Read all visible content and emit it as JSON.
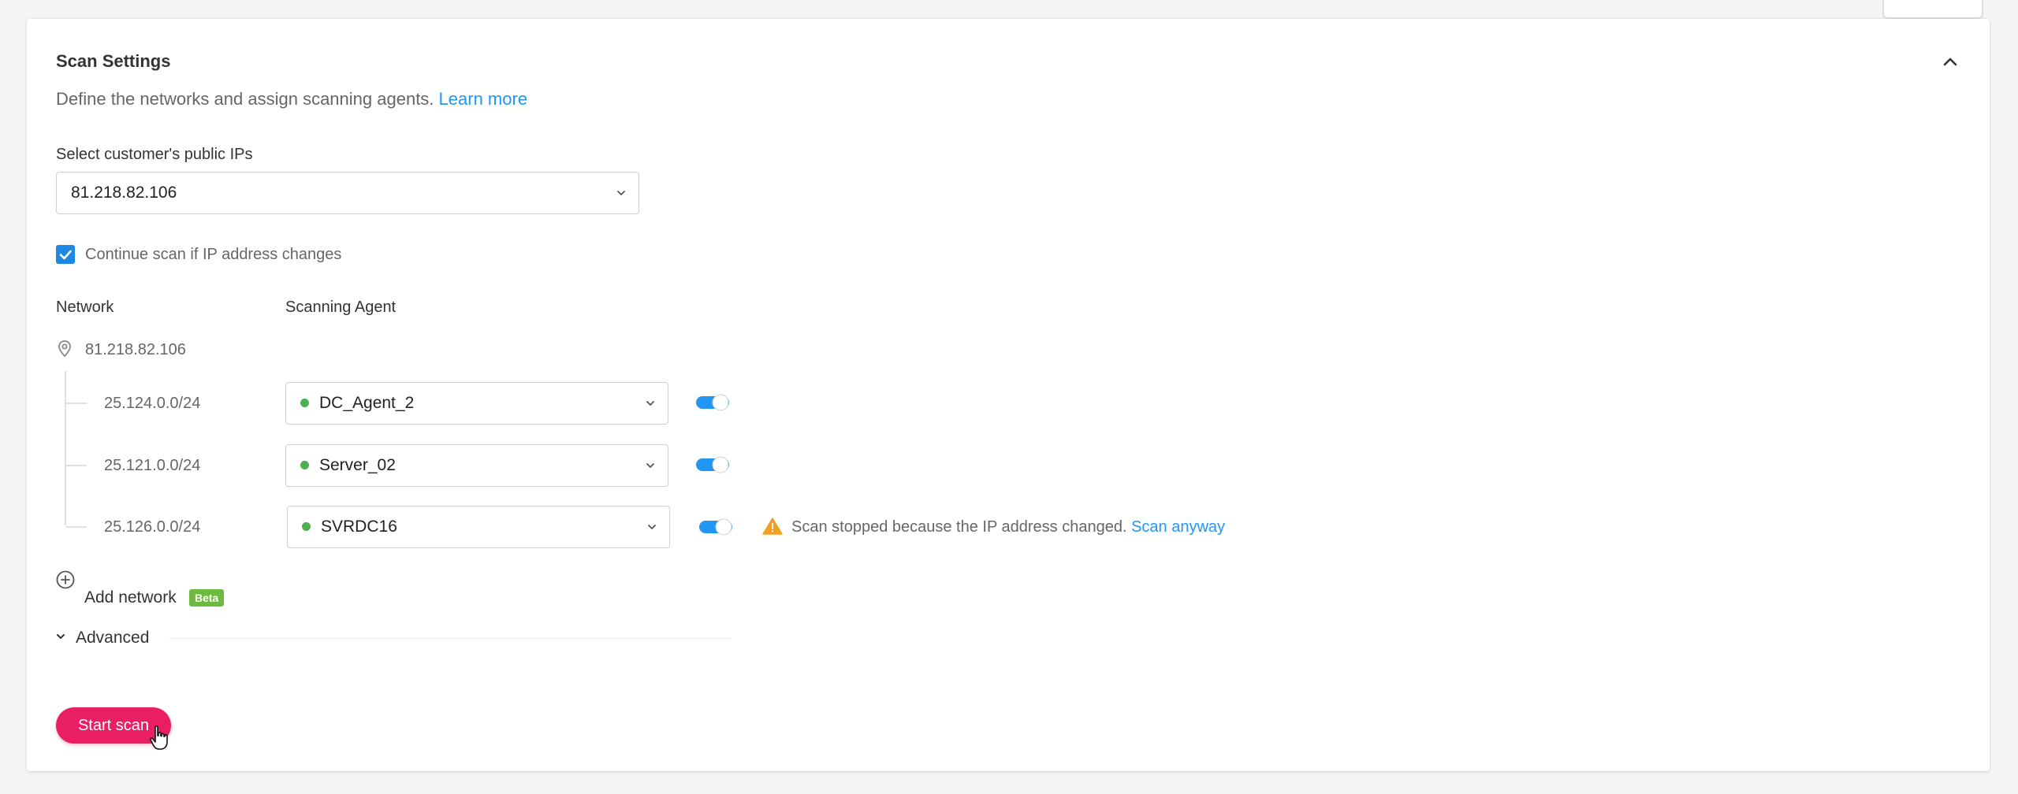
{
  "section": {
    "title": "Scan Settings",
    "description": "Define the networks and assign scanning agents.",
    "learn_more": "Learn more"
  },
  "public_ip": {
    "label": "Select customer's public IPs",
    "selected": "81.218.82.106"
  },
  "continue_scan": {
    "checked": true,
    "label": "Continue scan if IP address changes"
  },
  "columns": {
    "network": "Network",
    "agent": "Scanning Agent"
  },
  "root_network": "81.218.82.106",
  "networks": [
    {
      "subnet": "25.124.0.0/24",
      "agent": "DC_Agent_2",
      "agent_status": "online",
      "enabled": true
    },
    {
      "subnet": "25.121.0.0/24",
      "agent": "Server_02",
      "agent_status": "online",
      "enabled": true
    },
    {
      "subnet": "25.126.0.0/24",
      "agent": "SVRDC16",
      "agent_status": "online",
      "enabled": true
    }
  ],
  "warning": {
    "message": "Scan stopped because the IP address changed.",
    "action": "Scan anyway",
    "icon": "warning-triangle-icon"
  },
  "add_network": {
    "label": "Add network",
    "badge": "Beta"
  },
  "advanced": {
    "label": "Advanced"
  },
  "start_scan": "Start scan",
  "colors": {
    "accent": "#2196f3",
    "primary_button": "#e91e63",
    "online": "#4caf50",
    "warning": "#f0a020",
    "beta": "#6dbb3e"
  }
}
